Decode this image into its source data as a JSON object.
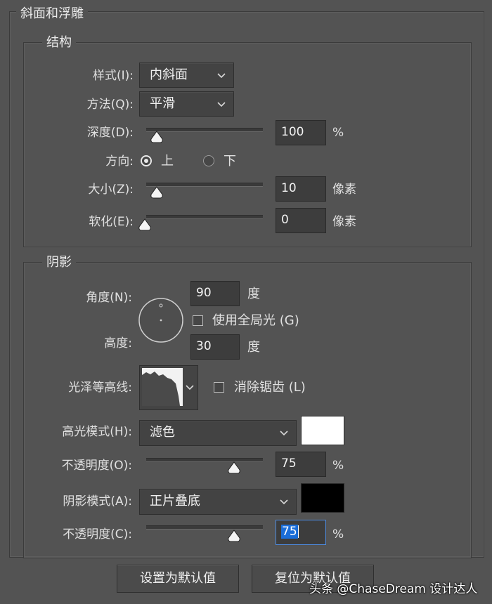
{
  "panel": {
    "title": "斜面和浮雕"
  },
  "structure": {
    "title": "结构",
    "style_label": "样式(I):",
    "style_value": "内斜面",
    "technique_label": "方法(Q):",
    "technique_value": "平滑",
    "depth_label": "深度(D):",
    "depth_value": "100",
    "depth_unit": "%",
    "depth_level": 0.1,
    "direction_label": "方向:",
    "direction_up": "上",
    "direction_down": "下",
    "size_label": "大小(Z):",
    "size_value": "10",
    "size_unit": "像素",
    "size_level": 0.1,
    "soften_label": "软化(E):",
    "soften_value": "0",
    "soften_unit": "像素",
    "soften_level": 0
  },
  "shading": {
    "title": "阴影",
    "angle_label": "角度(N):",
    "angle_value": "90",
    "angle_unit": "度",
    "global_light_label": "使用全局光 (G)",
    "altitude_label": "高度:",
    "altitude_value": "30",
    "altitude_unit": "度",
    "gloss_contour_label": "光泽等高线:",
    "anti_aliased_label": "消除锯齿 (L)",
    "highlight_mode_label": "高光模式(H):",
    "highlight_mode_value": "滤色",
    "highlight_color": "#ffffff",
    "highlight_opacity_label": "不透明度(O):",
    "highlight_opacity_value": "75",
    "highlight_opacity_unit": "%",
    "highlight_opacity_level": 0.75,
    "shadow_mode_label": "阴影模式(A):",
    "shadow_mode_value": "正片叠底",
    "shadow_color": "#000000",
    "shadow_opacity_label": "不透明度(C):",
    "shadow_opacity_value": "75",
    "shadow_opacity_unit": "%",
    "shadow_opacity_level": 0.75
  },
  "buttons": {
    "make_default": "设置为默认值",
    "reset_default": "复位为默认值"
  },
  "watermark": "头条 @ChaseDream 设计达人",
  "colors": {
    "background": "#535353",
    "field": "#3d3d3d",
    "selection": "#1a6dd8"
  }
}
